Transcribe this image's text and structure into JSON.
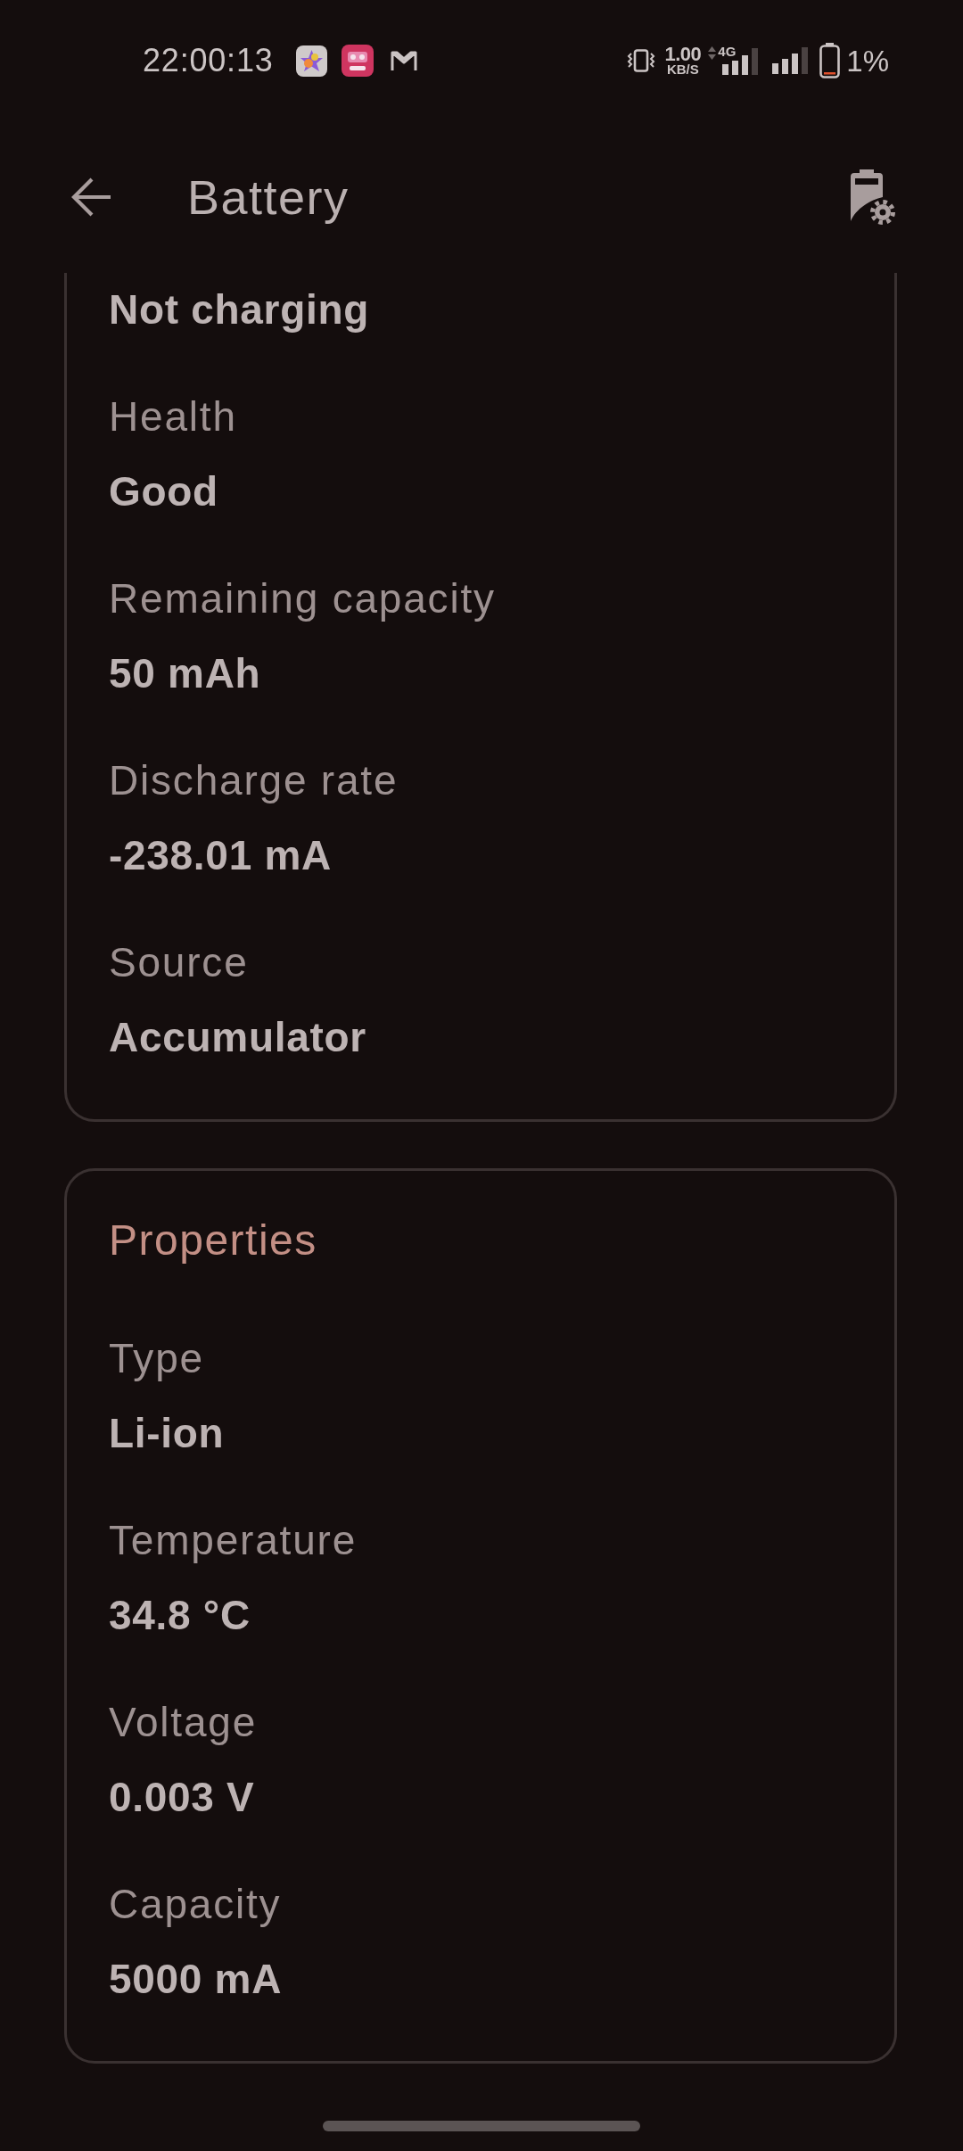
{
  "status_bar": {
    "time": "22:00:13",
    "network_speed": "1.00",
    "network_speed_unit": "KB/S",
    "network_type": "4G",
    "battery_percent": "1%"
  },
  "app_bar": {
    "title": "Battery"
  },
  "cards": [
    {
      "fields": [
        {
          "value": "Not charging"
        },
        {
          "label": "Health",
          "value": "Good"
        },
        {
          "label": "Remaining capacity",
          "value": "50 mAh"
        },
        {
          "label": "Discharge rate",
          "value": "-238.01 mA"
        },
        {
          "label": "Source",
          "value": "Accumulator"
        }
      ]
    },
    {
      "title": "Properties",
      "fields": [
        {
          "label": "Type",
          "value": "Li-ion"
        },
        {
          "label": "Temperature",
          "value": "34.8 °C"
        },
        {
          "label": "Voltage",
          "value": "0.003 V"
        },
        {
          "label": "Capacity",
          "value": "5000 mA"
        }
      ]
    }
  ]
}
